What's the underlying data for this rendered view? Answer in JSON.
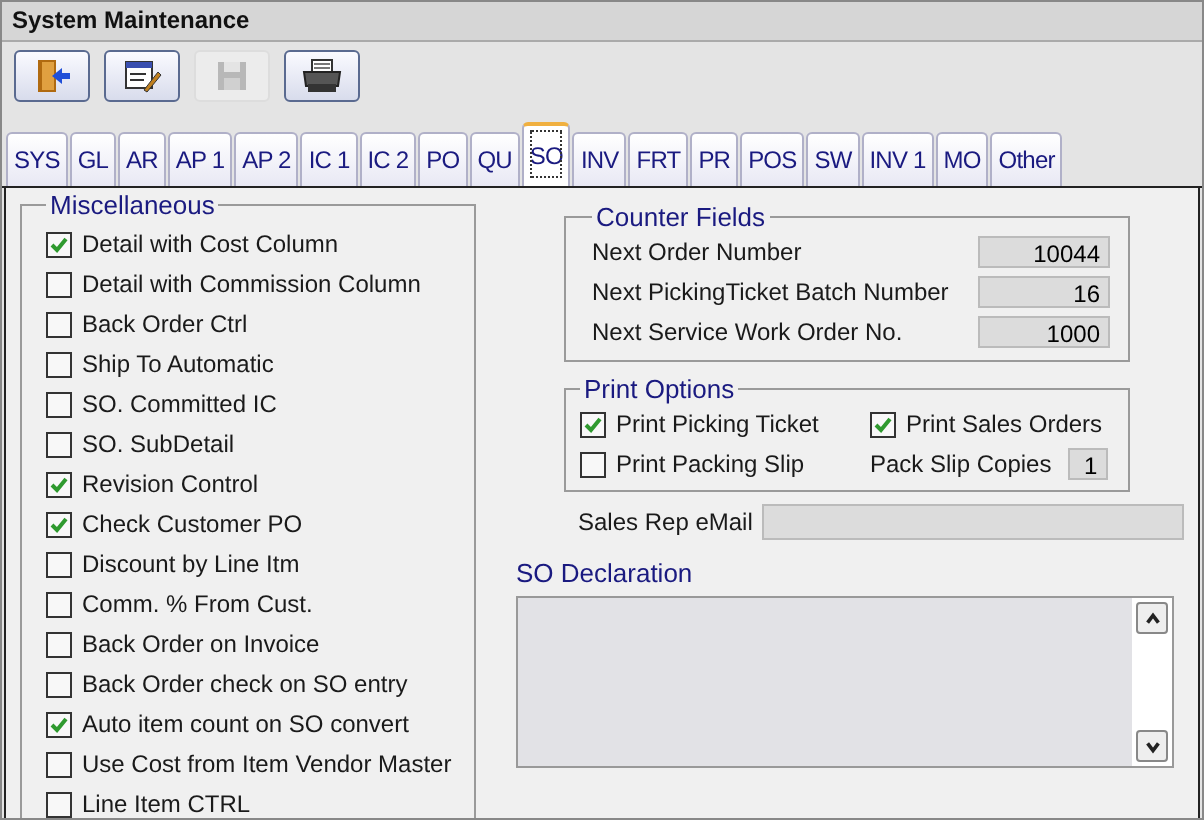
{
  "window": {
    "title": "System Maintenance"
  },
  "toolbar": [
    {
      "kind": "exit",
      "disabled": false
    },
    {
      "kind": "edit",
      "disabled": false
    },
    {
      "kind": "save",
      "disabled": true
    },
    {
      "kind": "print",
      "disabled": false
    }
  ],
  "tabs": [
    {
      "label": "SYS",
      "selected": false
    },
    {
      "label": "GL",
      "selected": false
    },
    {
      "label": "AR",
      "selected": false
    },
    {
      "label": "AP 1",
      "selected": false
    },
    {
      "label": "AP 2",
      "selected": false
    },
    {
      "label": "IC 1",
      "selected": false
    },
    {
      "label": "IC 2",
      "selected": false
    },
    {
      "label": "PO",
      "selected": false
    },
    {
      "label": "QU",
      "selected": false
    },
    {
      "label": "SO",
      "selected": true
    },
    {
      "label": "INV",
      "selected": false
    },
    {
      "label": "FRT",
      "selected": false
    },
    {
      "label": "PR",
      "selected": false
    },
    {
      "label": "POS",
      "selected": false
    },
    {
      "label": "SW",
      "selected": false
    },
    {
      "label": "INV 1",
      "selected": false
    },
    {
      "label": "MO",
      "selected": false
    },
    {
      "label": "Other",
      "selected": false
    }
  ],
  "miscellaneous": {
    "title": "Miscellaneous",
    "options": [
      {
        "label": "Detail with Cost Column",
        "checked": true
      },
      {
        "label": "Detail with Commission Column",
        "checked": false
      },
      {
        "label": "Back Order Ctrl",
        "checked": false
      },
      {
        "label": "Ship To  Automatic",
        "checked": false
      },
      {
        "label": "SO. Committed IC",
        "checked": false
      },
      {
        "label": "SO. SubDetail",
        "checked": false
      },
      {
        "label": "Revision Control",
        "checked": true
      },
      {
        "label": "Check Customer PO",
        "checked": true
      },
      {
        "label": "Discount by Line Itm",
        "checked": false
      },
      {
        "label": "Comm. % From Cust.",
        "checked": false
      },
      {
        "label": "Back Order on Invoice",
        "checked": false
      },
      {
        "label": "Back Order check on SO entry",
        "checked": false
      },
      {
        "label": "Auto item count on SO convert",
        "checked": true
      },
      {
        "label": "Use Cost from Item Vendor Master",
        "checked": false
      },
      {
        "label": "Line Item CTRL",
        "checked": false
      }
    ]
  },
  "counter_fields": {
    "title": "Counter Fields",
    "fields": [
      {
        "label": "Next Order Number",
        "value": "10044"
      },
      {
        "label": "Next PickingTicket Batch Number",
        "value": "16"
      },
      {
        "label": "Next Service Work Order No.",
        "value": "1000"
      }
    ]
  },
  "print_options": {
    "title": "Print Options",
    "options": [
      {
        "label": "Print Picking Ticket",
        "checked": true
      },
      {
        "label": "Print Sales Orders",
        "checked": true
      },
      {
        "label": "Print Packing Slip",
        "checked": false
      }
    ],
    "copies_label": "Pack Slip Copies",
    "copies_value": "1"
  },
  "sales_rep_email": {
    "label": "Sales Rep eMail"
  },
  "so_declaration": {
    "label": "SO Declaration"
  }
}
